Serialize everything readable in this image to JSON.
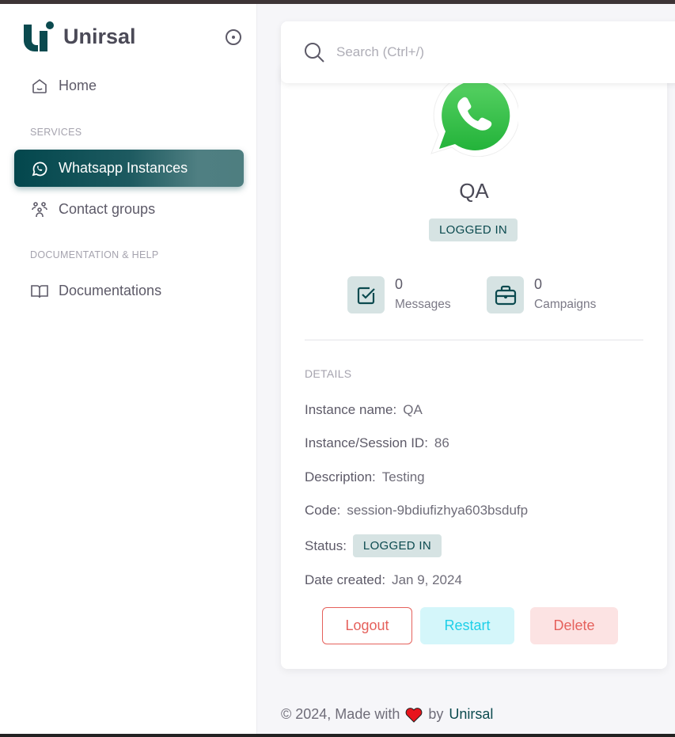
{
  "brand": {
    "name": "Unirsal"
  },
  "sidebar": {
    "home": "Home",
    "sections": [
      "SERVICES",
      "DOCUMENTATION & HELP"
    ],
    "items": [
      {
        "label": "Whatsapp Instances",
        "active": true
      },
      {
        "label": "Contact groups"
      },
      {
        "label": "Documentations"
      }
    ]
  },
  "search": {
    "placeholder": "Search (Ctrl+/)"
  },
  "instance": {
    "name": "QA",
    "status": "LOGGED IN",
    "stats": [
      {
        "value": "0",
        "label": "Messages"
      },
      {
        "value": "0",
        "label": "Campaigns"
      }
    ],
    "details_label": "DETAILS",
    "details": [
      {
        "label": "Instance name:",
        "value": "QA"
      },
      {
        "label": "Instance/Session ID:",
        "value": "86"
      },
      {
        "label": "Description:",
        "value": "Testing"
      },
      {
        "label": "Code:",
        "value": "session-9bdiufizhya603bsdufp"
      },
      {
        "label": "Status:",
        "value": "LOGGED IN"
      },
      {
        "label": "Date created:",
        "value": "Jan 9, 2024"
      }
    ],
    "buttons": {
      "logout": "Logout",
      "restart": "Restart",
      "delete": "Delete"
    }
  },
  "footer": {
    "prefix": "© 2024, Made with",
    "by": "by",
    "link": "Unirsal"
  },
  "colors": {
    "primary": "#03474d",
    "danger": "#e5615c",
    "info": "#1ecfe8",
    "whatsapp": "#25d366"
  }
}
